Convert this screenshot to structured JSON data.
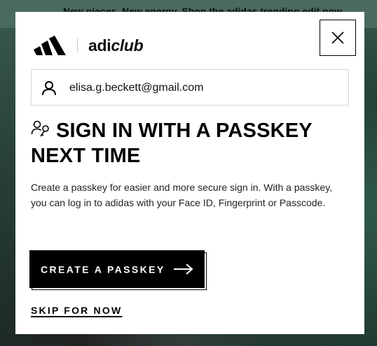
{
  "promo_banner": {
    "text": "New pieces. New energy. Shop the adidas trending edit now"
  },
  "header": {
    "logo_icon": "adidas-logo-icon",
    "brand_text_bold": "adi",
    "brand_text_italic": "club",
    "close_icon": "close-icon"
  },
  "account": {
    "person_icon": "person-icon",
    "email": "elisa.g.beckett@gmail.com"
  },
  "content": {
    "headline_icon": "passkey-icon",
    "headline": "SIGN IN WITH A PASSKEY NEXT TIME",
    "description": "Create a passkey for easier and more secure sign in. With a passkey, you can log in to adidas with your Face ID, Fingerprint or Passcode."
  },
  "actions": {
    "create_label": "CREATE A PASSKEY",
    "create_icon": "arrow-right-icon",
    "skip_label": "SKIP FOR NOW"
  }
}
